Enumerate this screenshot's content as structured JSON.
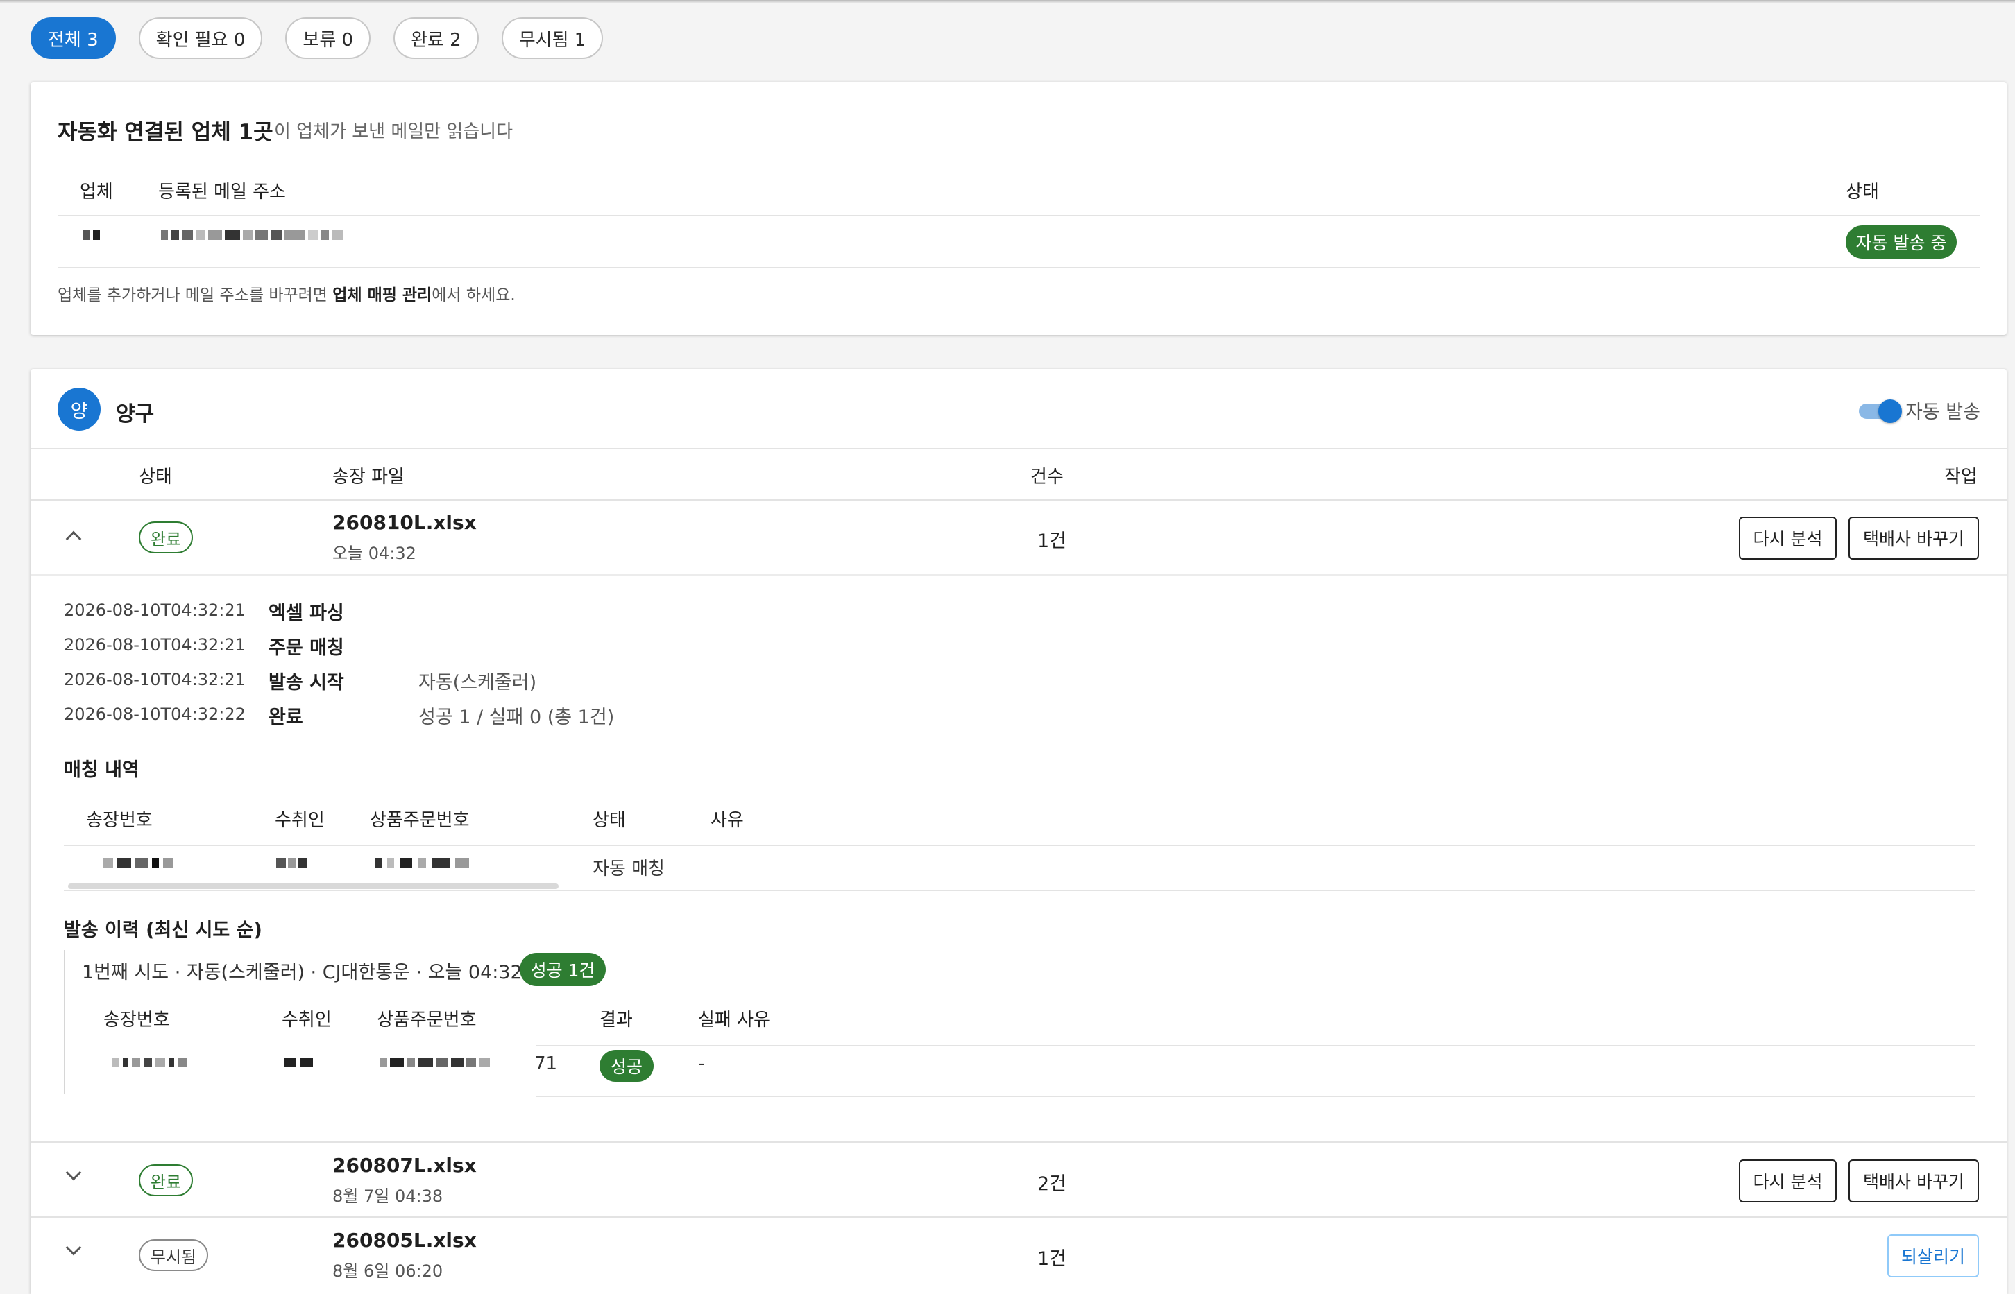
{
  "filters": [
    "전체 3",
    "확인 필요 0",
    "보류 0",
    "완료 2",
    "무시됨 1"
  ],
  "vendors_card": {
    "title": "자동화 연결된 업체 1곳",
    "subtitle": "이 업체가 보낸 메일만 읽습니다",
    "col_vendor": "업체",
    "col_email": "등록된 메일 주소",
    "col_status": "상태",
    "row_status": "자동 발송 중",
    "note_pre": "업체를 추가하거나 메일 주소를 바꾸려면 ",
    "note_bold": "업체 매핑 관리",
    "note_post": "에서 하세요."
  },
  "vendor_section": {
    "avatar": "양",
    "name": "양구",
    "toggle_label": "자동 발송",
    "toggle_on": true,
    "col_status": "상태",
    "col_file": "송장 파일",
    "col_count": "건수",
    "col_action": "작업"
  },
  "files": [
    {
      "status": "완료",
      "name": "260810L.xlsx",
      "time": "오늘 04:32",
      "count": "1건",
      "btn1": "다시 분석",
      "btn2": "택배사 바꾸기"
    },
    {
      "status": "완료",
      "name": "260807L.xlsx",
      "time": "8월 7일 04:38",
      "count": "2건",
      "btn1": "다시 분석",
      "btn2": "택배사 바꾸기"
    },
    {
      "status": "무시됨",
      "name": "260805L.xlsx",
      "time": "8월 6일 06:20",
      "count": "1건",
      "btn1": "되살리기"
    }
  ],
  "log": [
    {
      "ts": "2026-08-10T04:32:21",
      "step": "엑셀 파싱",
      "detail": ""
    },
    {
      "ts": "2026-08-10T04:32:21",
      "step": "주문 매칭",
      "detail": ""
    },
    {
      "ts": "2026-08-10T04:32:21",
      "step": "발송 시작",
      "detail": "자동(스케줄러)"
    },
    {
      "ts": "2026-08-10T04:32:22",
      "step": "완료",
      "detail": "성공 1 / 실패 0 (총 1건)"
    }
  ],
  "matching": {
    "title": "매칭 내역",
    "headers": [
      "송장번호",
      "수취인",
      "상품주문번호",
      "상태",
      "사유"
    ],
    "row_status": "자동 매칭",
    "row_reason": ""
  },
  "history": {
    "title": "발송 이력 (최신 시도 순)",
    "attempt_text": "1번째 시도 · 자동(스케줄러) · CJ대한통운 · 오늘 04:32",
    "attempt_badge": "성공 1건",
    "headers": [
      "송장번호",
      "수취인",
      "상품주문번호",
      "결과",
      "실패 사유"
    ],
    "order_suffix": "71",
    "row_result": "성공",
    "row_reason": "-"
  },
  "colors": {
    "accent": "#1976d2",
    "success": "#2e7d32"
  }
}
